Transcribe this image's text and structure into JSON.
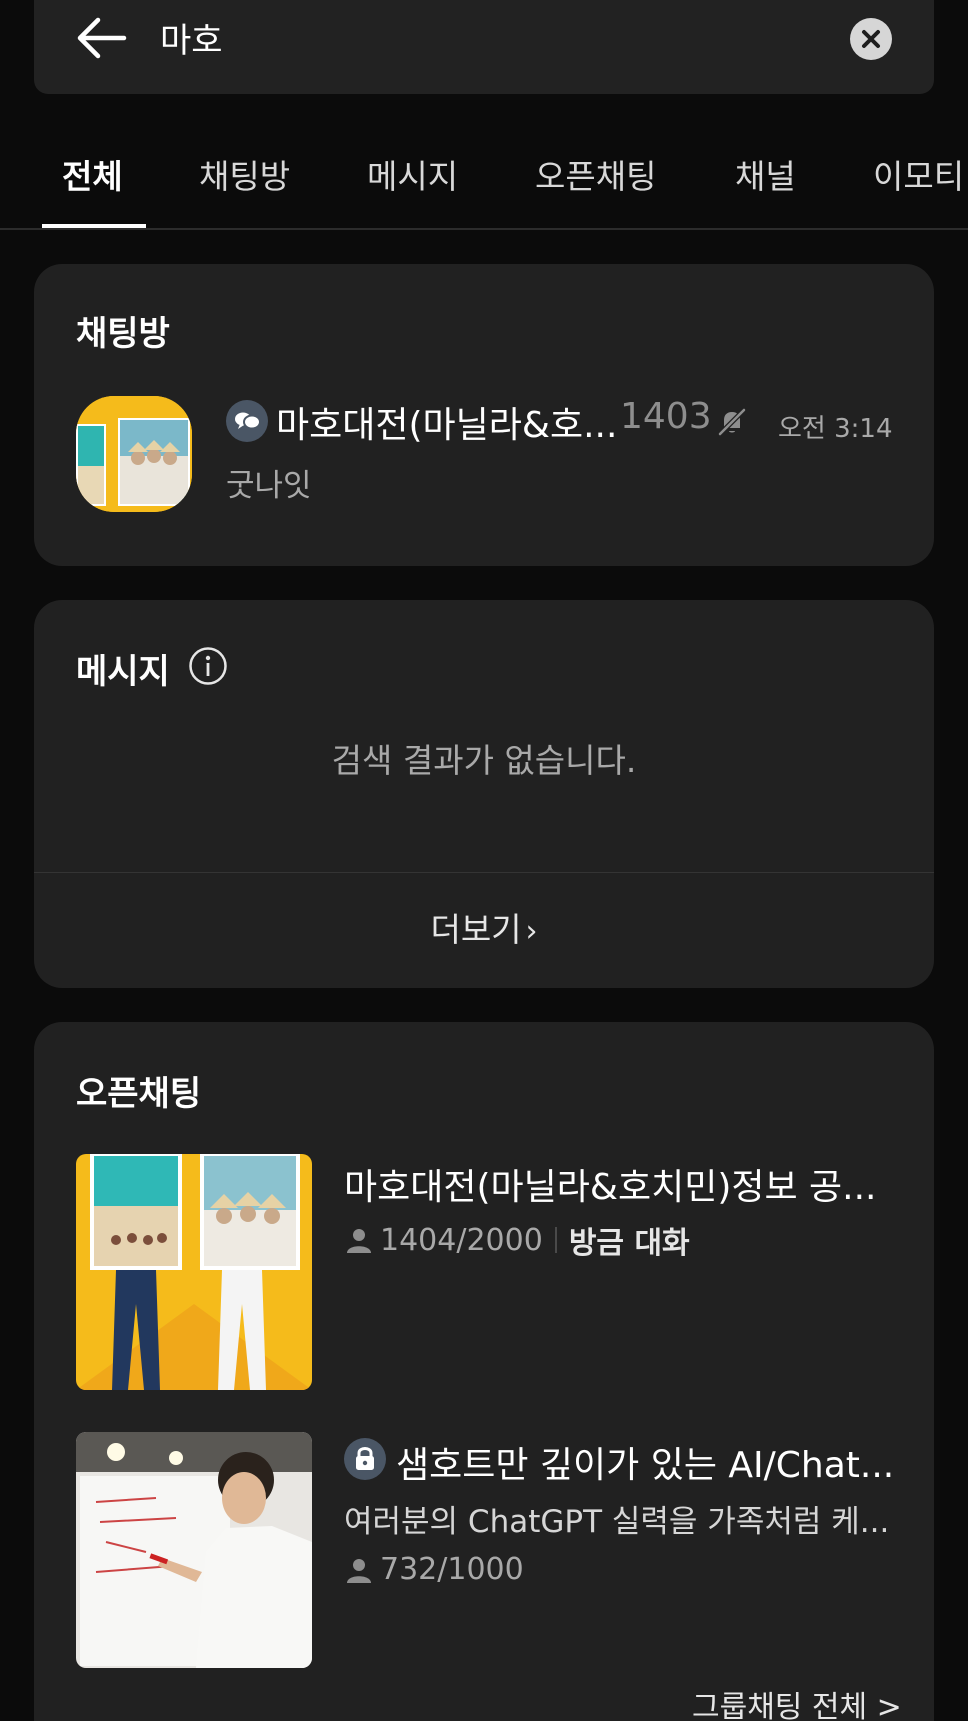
{
  "search": {
    "query": "마호",
    "back_icon": "arrow-left-icon",
    "clear_icon": "close-circle-icon"
  },
  "tabs": [
    {
      "label": "전체",
      "active": true
    },
    {
      "label": "채팅방",
      "active": false
    },
    {
      "label": "메시지",
      "active": false
    },
    {
      "label": "오픈채팅",
      "active": false
    },
    {
      "label": "채널",
      "active": false
    },
    {
      "label": "이모티",
      "active": false
    }
  ],
  "chat_rooms": {
    "title": "채팅방",
    "items": [
      {
        "name": "마호대전(마닐라&호...",
        "member_count": "1403",
        "time": "오전 3:14",
        "preview": "굿나잇",
        "type_icon": "open-chat-bubble-icon",
        "muted_icon": "bell-off-icon"
      }
    ]
  },
  "messages": {
    "title": "메시지",
    "info_icon": "info-icon",
    "empty_text": "검색 결과가 없습니다.",
    "more_label": "더보기"
  },
  "open_chats": {
    "title": "오픈채팅",
    "items": [
      {
        "title": "마호대전(마닐라&호치민)정보 공...",
        "members": "1404/2000",
        "activity": "방금 대화"
      },
      {
        "title": "샘호트만 깊이가 있는 AI/Chat...",
        "description": "여러분의 ChatGPT 실력을 가족처럼 케...",
        "members": "732/1000",
        "lock_icon": "lock-icon"
      }
    ],
    "footer_link": "그룹채팅 전체 >"
  },
  "colors": {
    "background": "#0b0b0b",
    "card": "#212121",
    "text_primary": "#ffffff",
    "text_secondary": "#a9a9a9",
    "thumb_yellow": "#f5bb1b",
    "badge": "#4a5665"
  }
}
